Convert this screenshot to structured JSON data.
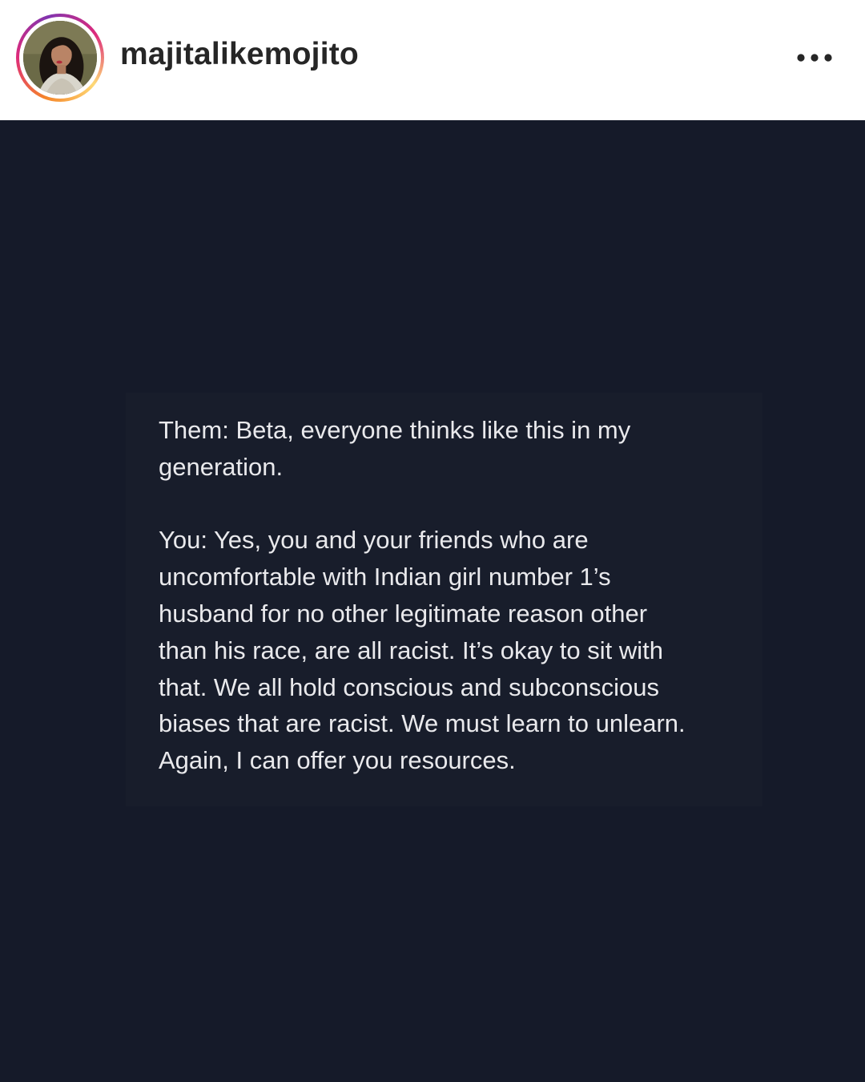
{
  "header": {
    "username": "majitalikemojito",
    "avatar_icon": "profile-photo",
    "more_icon": "more-horizontal-icon",
    "story_ring_colors": [
      "#f58529",
      "#dd2a7b",
      "#8134af",
      "#feda77"
    ]
  },
  "post": {
    "background_color": "#151a29",
    "text_color": "#e9e9ec",
    "note": {
      "line_1": "Them: Beta, everyone thinks like this in my",
      "line_2": "generation.",
      "line_3": "You: Yes,  you and your friends who are",
      "line_4": "uncomfortable with Indian girl number 1’s",
      "line_5": "husband for no other legitimate reason other",
      "line_6": "than his race, are all racist. It’s okay to sit with",
      "line_7": "that. We all hold conscious and subconscious",
      "line_8": "biases that are racist. We must learn to unlearn.",
      "line_9": "Again, I can offer you resources."
    }
  }
}
